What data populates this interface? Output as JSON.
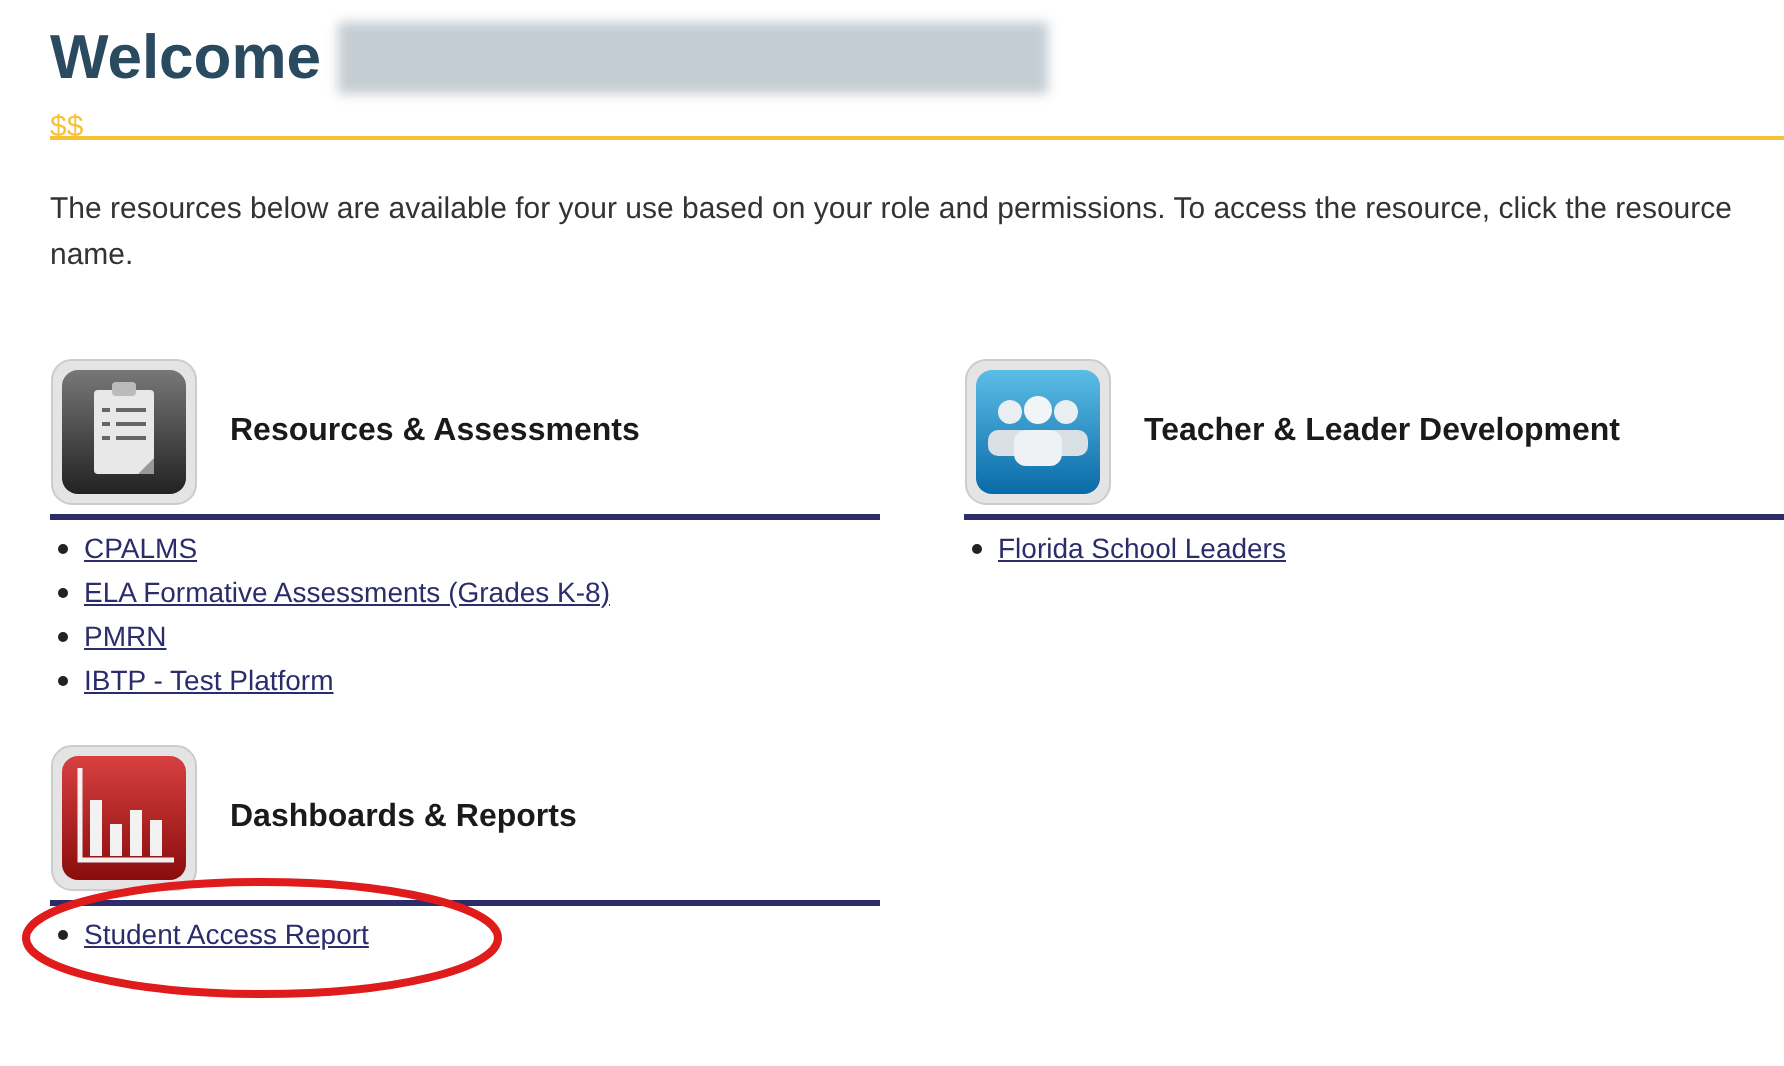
{
  "header": {
    "title": "Welcome",
    "redacted": true,
    "mark": "$$"
  },
  "intro": "The resources below are available for your use based on your role and permissions. To access the resource, click the resource name.",
  "columns": [
    {
      "sections": [
        {
          "title": "Resources & Assessments",
          "kind": "clipboard",
          "links": [
            {
              "label": "CPALMS",
              "circled": false
            },
            {
              "label": "ELA Formative Assessments (Grades K-8)",
              "circled": false
            },
            {
              "label": "PMRN",
              "circled": false
            },
            {
              "label": "IBTP - Test Platform",
              "circled": false
            }
          ]
        },
        {
          "title": "Dashboards & Reports",
          "kind": "chart",
          "links": [
            {
              "label": "Student Access Report",
              "circled": true
            }
          ]
        }
      ]
    },
    {
      "sections": [
        {
          "title": "Teacher & Leader Development",
          "kind": "people",
          "links": [
            {
              "label": "Florida School Leaders",
              "circled": false
            }
          ]
        }
      ]
    }
  ]
}
